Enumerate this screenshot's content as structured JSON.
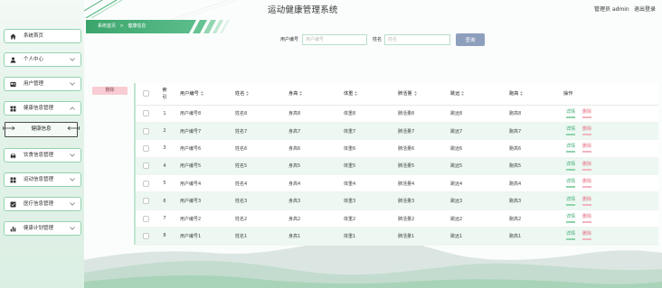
{
  "app": {
    "title": "运动健康管理系统"
  },
  "header": {
    "role": "管理员",
    "username": "admin",
    "logout_label": "退出登录"
  },
  "sidebar": {
    "items": [
      {
        "label": "系统首页",
        "icon": "home-icon"
      },
      {
        "label": "个人中心",
        "icon": "user-icon",
        "chevron": "chevron-down-icon"
      },
      {
        "label": "用户管理",
        "icon": "id-card-icon",
        "chevron": "chevron-down-icon"
      },
      {
        "label": "健康信息管理",
        "icon": "grid-icon",
        "chevron": "chevron-up-icon",
        "expanded": true,
        "children": [
          {
            "label": "健康信息",
            "active": true
          }
        ]
      },
      {
        "label": "饮食信息管理",
        "icon": "car-icon",
        "chevron": "chevron-down-icon"
      },
      {
        "label": "运动信息管理",
        "icon": "grid-icon",
        "chevron": "chevron-down-icon"
      },
      {
        "label": "医疗信息管理",
        "icon": "checkbox-icon",
        "chevron": "chevron-down-icon"
      },
      {
        "label": "健康计划管理",
        "icon": "bar-chart-icon",
        "chevron": "chevron-down-icon"
      }
    ]
  },
  "breadcrumb": {
    "home": "系统首页",
    "separator": ">",
    "current": "健康信息"
  },
  "search": {
    "fields": [
      {
        "label": "用户编号",
        "placeholder": "用户编号",
        "value": ""
      },
      {
        "label": "姓名",
        "placeholder": "姓名",
        "value": ""
      }
    ],
    "button_label": "查询"
  },
  "toolbar": {
    "delete_label": "删除"
  },
  "table": {
    "sort_icon": "sort-icon",
    "columns": [
      {
        "label": "索引"
      },
      {
        "label": "用户编号",
        "sortable": true
      },
      {
        "label": "姓名",
        "sortable": true
      },
      {
        "label": "身高",
        "sortable": true
      },
      {
        "label": "体重",
        "sortable": true
      },
      {
        "label": "肺活量",
        "sortable": true
      },
      {
        "label": "跳远",
        "sortable": true
      },
      {
        "label": "跑高",
        "sortable": true
      },
      {
        "label": "操作"
      }
    ],
    "row_actions": {
      "detail": "详情",
      "delete": "删除"
    },
    "rows": [
      {
        "index": "1",
        "user_no": "用户编号8",
        "name": "姓名8",
        "height": "身高8",
        "weight": "体重8",
        "lung_capacity": "肺活量8",
        "long_jump": "跳远8",
        "run_high": "跑高8"
      },
      {
        "index": "2",
        "user_no": "用户编号7",
        "name": "姓名7",
        "height": "身高7",
        "weight": "体重7",
        "lung_capacity": "肺活量7",
        "long_jump": "跳远7",
        "run_high": "跑高7"
      },
      {
        "index": "3",
        "user_no": "用户编号6",
        "name": "姓名6",
        "height": "身高6",
        "weight": "体重6",
        "lung_capacity": "肺活量6",
        "long_jump": "跳远6",
        "run_high": "跑高6"
      },
      {
        "index": "4",
        "user_no": "用户编号5",
        "name": "姓名5",
        "height": "身高5",
        "weight": "体重5",
        "lung_capacity": "肺活量5",
        "long_jump": "跳远5",
        "run_high": "跑高5"
      },
      {
        "index": "5",
        "user_no": "用户编号4",
        "name": "姓名4",
        "height": "身高4",
        "weight": "体重4",
        "lung_capacity": "肺活量4",
        "long_jump": "跳远4",
        "run_high": "跑高4"
      },
      {
        "index": "6",
        "user_no": "用户编号3",
        "name": "姓名3",
        "height": "身高3",
        "weight": "体重3",
        "lung_capacity": "肺活量3",
        "long_jump": "跳远3",
        "run_high": "跑高3"
      },
      {
        "index": "7",
        "user_no": "用户编号2",
        "name": "姓名2",
        "height": "身高2",
        "weight": "体重2",
        "lung_capacity": "肺活量2",
        "long_jump": "跳远2",
        "run_high": "跑高2"
      },
      {
        "index": "8",
        "user_no": "用户编号1",
        "name": "姓名1",
        "height": "身高1",
        "weight": "体重1",
        "lung_capacity": "肺活量1",
        "long_jump": "跳远1",
        "run_high": "跑高1"
      }
    ]
  },
  "colors": {
    "accent": "#3fae72",
    "row_alt": "#ecf8f1",
    "link_detail": "#3aa86e",
    "link_delete": "#e46c7f",
    "search_button": "#8d9fbd",
    "delete_button": "#f8ccd2"
  }
}
